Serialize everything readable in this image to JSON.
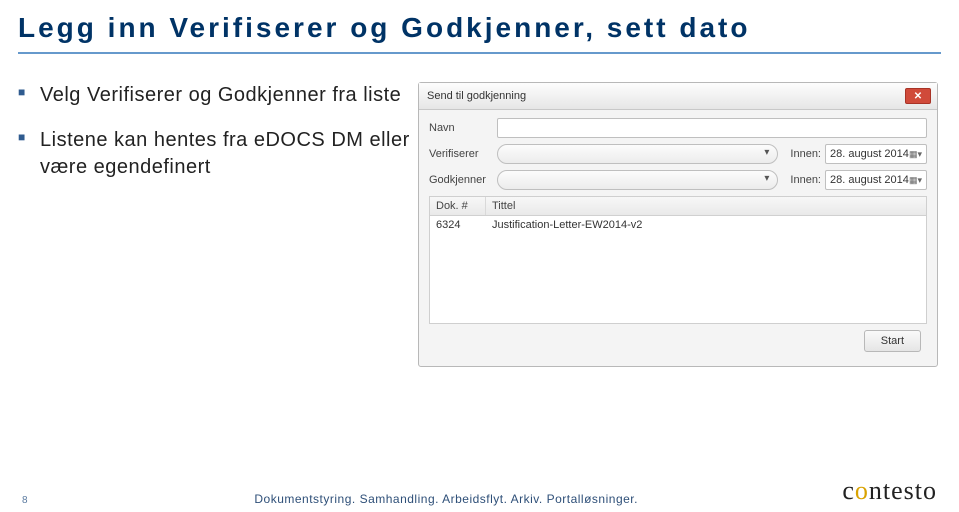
{
  "slide": {
    "title": "Legg inn Verifiserer og Godkjenner, sett dato"
  },
  "bullets": {
    "items": [
      "Velg Verifiserer og Godkjenner fra liste",
      "Listene kan hentes fra eDOCS DM eller være egendefinert"
    ]
  },
  "dialog": {
    "title": "Send til godkjenning",
    "labels": {
      "navn": "Navn",
      "verifiserer": "Verifiserer",
      "godkjenner": "Godkjenner",
      "innen": "Innen:"
    },
    "dates": {
      "verifiserer": "28. august 2014",
      "godkjenner": "28. august 2014"
    },
    "table": {
      "headers": {
        "dok": "Dok. #",
        "tittel": "Tittel"
      },
      "rows": [
        {
          "dok": "6324",
          "tittel": "Justification-Letter-EW2014-v2"
        }
      ]
    },
    "start_label": "Start",
    "close_label": "✕"
  },
  "footer": {
    "page": "8",
    "text": "Dokumentstyring. Samhandling. Arbeidsflyt. Arkiv. Portalløsninger.",
    "logo_plain": "c",
    "logo_o": "o",
    "logo_rest": "ntesto"
  }
}
